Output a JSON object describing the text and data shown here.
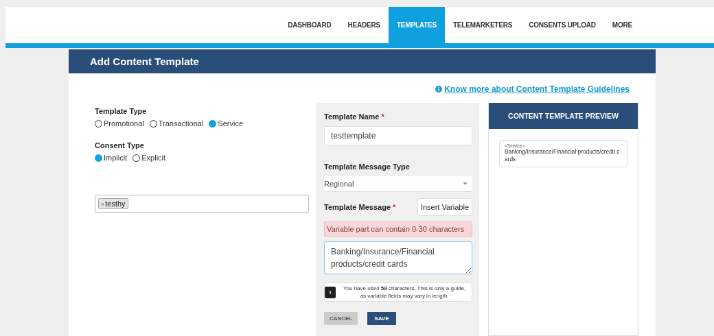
{
  "nav": {
    "tabs": [
      {
        "label": "DASHBOARD",
        "selected": false
      },
      {
        "label": "HEADERS",
        "selected": false
      },
      {
        "label": "TEMPLATES",
        "selected": true
      },
      {
        "label": "TELEMARKETERS",
        "selected": false
      },
      {
        "label": "CONSENTS UPLOAD",
        "selected": false
      },
      {
        "label": "MORE",
        "selected": false
      }
    ]
  },
  "card": {
    "title": "Add Content Template",
    "guidelines_link": "Know more about Content Template Guidelines"
  },
  "template_type": {
    "label": "Template Type",
    "options": [
      {
        "label": "Promotional",
        "selected": false
      },
      {
        "label": "Transactional",
        "selected": false
      },
      {
        "label": "Service",
        "selected": true
      }
    ]
  },
  "consent_type": {
    "label": "Consent Type",
    "options": [
      {
        "label": "Implicit",
        "selected": true
      },
      {
        "label": "Explicit",
        "selected": false
      }
    ]
  },
  "tags": [
    "testhy"
  ],
  "tag_remove": "×",
  "form": {
    "name_label": "Template Name",
    "required": "*",
    "name_value": "testtemplate",
    "message_type_label": "Template Message Type",
    "message_type_value": "Regional",
    "message_label": "Template Message",
    "insert_variable": "Insert Variable",
    "alert": "Variable part can contain 0-30 characters",
    "message_value": "Banking/Insurance/Financial products/credit cards",
    "info_icon": "i",
    "info": "You have used **58** characters. This is only a guide, as variable fields may vary in length.",
    "cancel": "CANCEL",
    "save": "SAVE"
  },
  "preview": {
    "title": "CONTENT TEMPLATE PREVIEW",
    "header": "<Service>",
    "body": "Banking/Insurance/Financial products/credit cards"
  }
}
